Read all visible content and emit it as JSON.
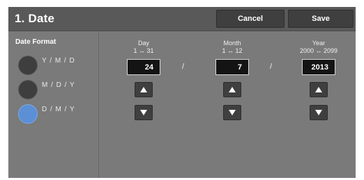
{
  "header": {
    "title": "1. Date",
    "cancel_label": "Cancel",
    "save_label": "Save"
  },
  "date_format": {
    "label": "Date Format",
    "options": [
      {
        "label": "Y / M / D",
        "selected": false
      },
      {
        "label": "M / D / Y",
        "selected": false
      },
      {
        "label": "D / M / Y",
        "selected": true
      }
    ]
  },
  "fields": {
    "day": {
      "label": "Day",
      "range": "1 ↔ 31",
      "value": "24"
    },
    "month": {
      "label": "Month",
      "range": "1 ↔ 12",
      "value": "7"
    },
    "year": {
      "label": "Year",
      "range": "2000 ↔ 2099",
      "value": "2013"
    },
    "separator": "/"
  },
  "colors": {
    "panel": "#7a7a7a",
    "header": "#595959",
    "selected_radio": "#5b8fd6",
    "value_box": "#141414"
  }
}
